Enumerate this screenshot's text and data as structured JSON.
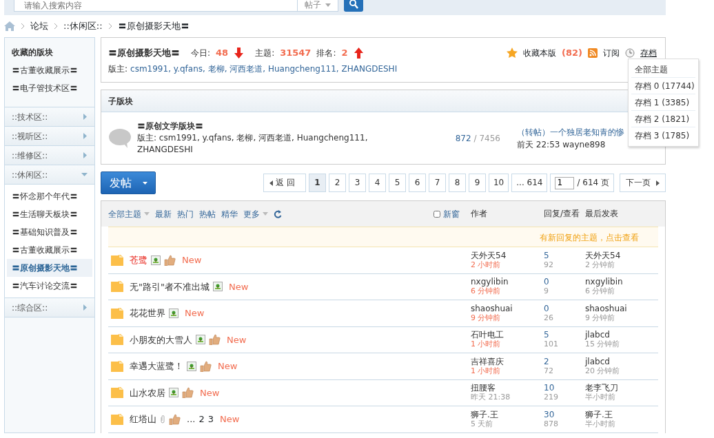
{
  "search": {
    "placeholder": "请输入搜索内容",
    "scope": "帖子"
  },
  "breadcrumb": [
    "论坛",
    "::休闲区::",
    "〓原创摄影天地〓"
  ],
  "forum": {
    "title": "〓原创摄影天地〓",
    "today_label": "今日:",
    "today": "48",
    "today_falling": true,
    "topics_label": "主题:",
    "topics": "31547",
    "rank_label": "排名:",
    "rank": "2",
    "rank_falling": false,
    "moderators_label": "版主:",
    "moderators": "csm1991, y.qfans, 老柳, 河西老道, Huangcheng111, ZHANGDESHI",
    "favorite": "收藏本版",
    "favorite_count": "(82)",
    "subscribe": "订阅",
    "archive": "存档"
  },
  "archive_menu": [
    "全部主题",
    "存档 0 (17744)",
    "存档 1 (3385)",
    "存档 2 (1821)",
    "存档 3 (1785)"
  ],
  "sidebar": {
    "favorites_title": "收藏的版块",
    "favorites": [
      "〓古董收藏展示〓",
      "〓电子管技术区〓"
    ],
    "groups": [
      {
        "label": "::技术区::",
        "expanded": false
      },
      {
        "label": "::视听区::",
        "expanded": false
      },
      {
        "label": "::维修区::",
        "expanded": false
      },
      {
        "label": "::休闲区::",
        "expanded": true,
        "children": [
          {
            "label": "〓怀念那个年代〓",
            "selected": false
          },
          {
            "label": "〓生活聊天板块〓",
            "selected": false
          },
          {
            "label": "〓基础知识普及〓",
            "selected": false
          },
          {
            "label": "〓古董收藏展示〓",
            "selected": false
          },
          {
            "label": "〓原创摄影天地〓",
            "selected": true
          },
          {
            "label": "〓汽车讨论交流〓",
            "selected": false
          }
        ]
      },
      {
        "label": "::综合区::",
        "expanded": false
      }
    ]
  },
  "subforums": {
    "title": "子版块",
    "items": [
      {
        "name": "〓原创文学版块〓",
        "moderators": "版主: csm1991, y.qfans, 老柳, 河西老道, Huangcheng111, ZHANGDESHI",
        "topics": "872",
        "posts": "/ 7456",
        "last_title": "（转帖）一个独居老知青的惨",
        "last_info": "前天 22:53 wayne898"
      }
    ]
  },
  "post_button": "发帖",
  "pagination": {
    "back": "返 回",
    "pages": [
      {
        "label": "1",
        "selected": true
      },
      {
        "label": "2",
        "selected": false
      },
      {
        "label": "3",
        "selected": false
      },
      {
        "label": "4",
        "selected": false
      },
      {
        "label": "5",
        "selected": false
      },
      {
        "label": "6",
        "selected": false
      },
      {
        "label": "7",
        "selected": false
      },
      {
        "label": "8",
        "selected": false
      },
      {
        "label": "9",
        "selected": false
      },
      {
        "label": "10",
        "selected": false
      }
    ],
    "last": "... 614",
    "page_input": "1",
    "total": "/ 614 页",
    "next": "下一页"
  },
  "filters": [
    {
      "label": "全部主题",
      "dropdown": true
    },
    {
      "label": "最新",
      "dropdown": false
    },
    {
      "label": "热门",
      "dropdown": false
    },
    {
      "label": "热帖",
      "dropdown": false
    },
    {
      "label": "精华",
      "dropdown": false
    },
    {
      "label": "更多",
      "dropdown": true
    }
  ],
  "new_window": {
    "label": "新窗",
    "checked": false
  },
  "columns": [
    "作者",
    "回复/查看",
    "最后发表"
  ],
  "notice": "有新回复的主题，点击查看",
  "threads": [
    {
      "title": "苍鹭",
      "highlight": true,
      "image": true,
      "liked": true,
      "attachment": false,
      "new": "New",
      "author": "天外天54",
      "author_time": "2 小时前",
      "recent": true,
      "replies": "5",
      "views": "92",
      "last_poster": "天外天54",
      "last_time": "2 分钟前"
    },
    {
      "title": "无\"路引\"者不准出城",
      "highlight": false,
      "image": true,
      "liked": false,
      "attachment": false,
      "new": "New",
      "author": "nxgylibin",
      "author_time": "6 分钟前",
      "recent": true,
      "replies": "0",
      "views": "9",
      "last_poster": "nxgylibin",
      "last_time": "6 分钟前"
    },
    {
      "title": "花花世界",
      "highlight": false,
      "image": true,
      "liked": false,
      "attachment": false,
      "new": "New",
      "author": "shaoshuai",
      "author_time": "9 分钟前",
      "recent": true,
      "replies": "0",
      "views": "26",
      "last_poster": "shaoshuai",
      "last_time": "9 分钟前"
    },
    {
      "title": "小朋友的大雪人",
      "highlight": false,
      "image": true,
      "liked": true,
      "attachment": false,
      "new": "New",
      "author": "石叶电工",
      "author_time": "1 小时前",
      "recent": true,
      "replies": "5",
      "views": "101",
      "last_poster": "jlabcd",
      "last_time": "15 分钟前"
    },
    {
      "title": "幸遇大蓝鹭！",
      "highlight": false,
      "image": true,
      "liked": true,
      "attachment": false,
      "new": "New",
      "author": "吉祥喜庆",
      "author_time": "1 小时前",
      "recent": true,
      "replies": "2",
      "views": "72",
      "last_poster": "jlabcd",
      "last_time": "20 分钟前"
    },
    {
      "title": "山水农居",
      "highlight": false,
      "image": true,
      "liked": true,
      "attachment": false,
      "new": "New",
      "author": "扭腰客",
      "author_time": "昨天 21:38",
      "recent": false,
      "replies": "10",
      "views": "219",
      "last_poster": "老李飞刀",
      "last_time": "半小时前"
    },
    {
      "title": "红塔山",
      "highlight": false,
      "image": false,
      "liked": true,
      "attachment": true,
      "ellipsis": "...",
      "pages": [
        "2",
        "3"
      ],
      "new": "New",
      "author": "狮子.王",
      "author_time": "5 天前",
      "recent": false,
      "replies": "30",
      "views": "878",
      "last_poster": "狮子.王",
      "last_time": "半小时前"
    }
  ]
}
